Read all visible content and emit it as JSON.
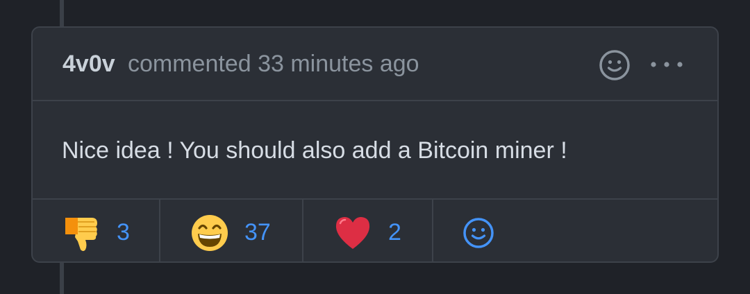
{
  "comment": {
    "author": "4v0v",
    "meta": "commented 33 minutes ago",
    "body": "Nice idea ! You should also add a Bitcoin miner !"
  },
  "header": {
    "react_icon": "smiley-icon",
    "more_icon": "kebab-horizontal-icon"
  },
  "reactions": [
    {
      "emoji": "thumbs-down",
      "count": "3"
    },
    {
      "emoji": "grinning-face-with-smiling-eyes",
      "count": "37"
    },
    {
      "emoji": "red-heart",
      "count": "2"
    }
  ],
  "add_reaction_icon": "smiley-icon",
  "colors": {
    "background": "#1f2228",
    "card": "#2b2f36",
    "border": "#3d424a",
    "muted_text": "#8b949e",
    "accent": "#4493f8"
  }
}
